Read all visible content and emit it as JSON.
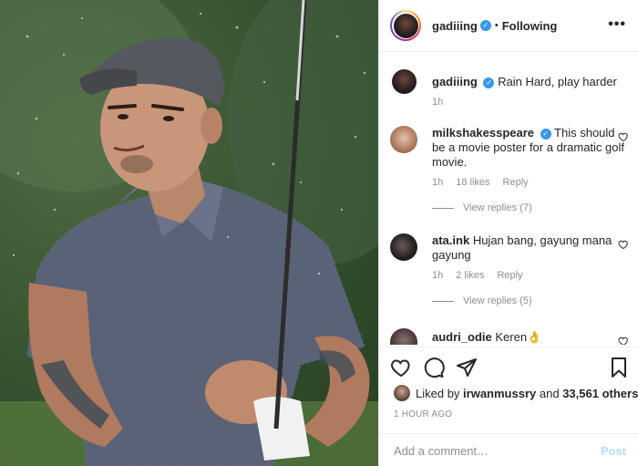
{
  "header": {
    "username": "gadiiing",
    "separator": "•",
    "follow_status": "Following",
    "more_label": "•••"
  },
  "caption": {
    "username": "gadiiing",
    "text": "Rain Hard, play harder",
    "time": "1h"
  },
  "comments": [
    {
      "username": "milkshakesspeare",
      "verified": true,
      "text": "This should be a movie poster for a dramatic golf movie.",
      "time": "1h",
      "likes": "18 likes",
      "reply_label": "Reply",
      "view_replies": "View replies (7)"
    },
    {
      "username": "ata.ink",
      "verified": false,
      "text": "Hujan bang, gayung mana gayung",
      "time": "1h",
      "likes": "2 likes",
      "reply_label": "Reply",
      "view_replies": "View replies (5)"
    },
    {
      "username": "audri_odie",
      "verified": false,
      "text": "Keren👌",
      "time": "",
      "likes": "",
      "reply_label": "",
      "view_replies": ""
    }
  ],
  "actions": {
    "liked_prefix": "Liked by",
    "liked_user": "irwanmussry",
    "liked_and": "and",
    "liked_count": "33,561 others",
    "timestamp": "1 HOUR AGO"
  },
  "comment_box": {
    "placeholder": "Add a comment…",
    "post_label": "Post"
  },
  "icons": {
    "verified": "verified-badge-icon",
    "heart": "heart-icon",
    "comment": "comment-icon",
    "share": "share-icon",
    "bookmark": "bookmark-icon",
    "more": "more-options-icon"
  },
  "colors": {
    "link_blue": "#3897f0",
    "muted": "#8e8e8e",
    "post_disabled": "#b2dffc"
  }
}
